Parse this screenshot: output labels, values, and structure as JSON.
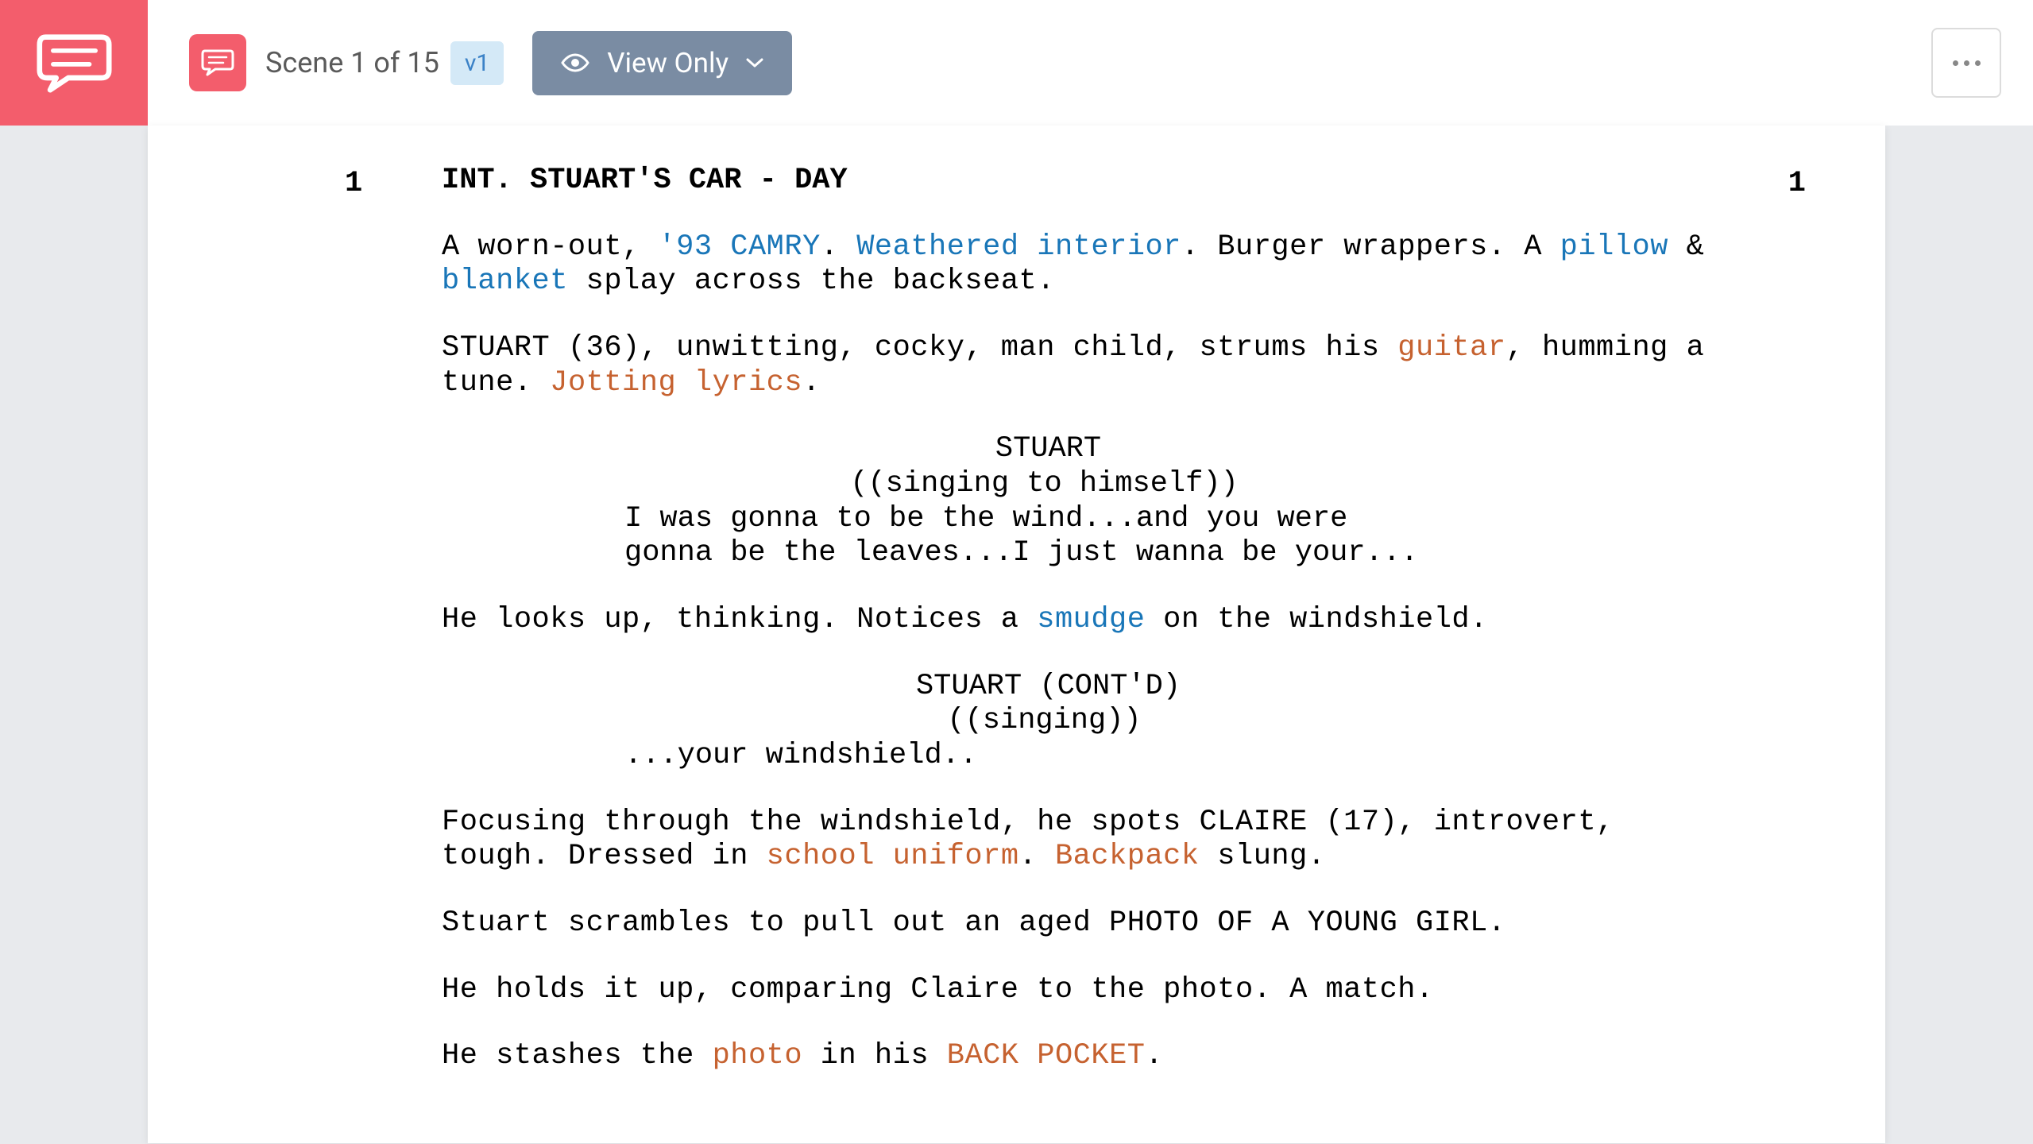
{
  "toolbar": {
    "scene_label": "Scene 1 of 15",
    "version_label": "v1",
    "view_only_label": "View Only"
  },
  "scene": {
    "number_left": "1",
    "number_right": "1",
    "heading": "INT. STUART'S CAR - DAY"
  },
  "action1": {
    "t1": "A worn-out, ",
    "t2": "'93 CAMRY",
    "t3": ". ",
    "t4": "Weathered interior",
    "t5": ". Burger wrappers. A ",
    "t6": "pillow",
    "t7": " & ",
    "t8": "blanket",
    "t9": " splay across the backseat."
  },
  "action2": {
    "t1": "STUART (36), unwitting, cocky, man child, strums his ",
    "t2": "guitar",
    "t3": ", humming a tune. ",
    "t4": "Jotting lyrics",
    "t5": "."
  },
  "dialogue1": {
    "character": "STUART",
    "parenthetical": "((singing to himself))",
    "text": "I was gonna to be the wind...and you were gonna be the leaves...I just wanna be your..."
  },
  "action3": {
    "t1": "He looks up, thinking. Notices a ",
    "t2": "smudge",
    "t3": " on the windshield."
  },
  "dialogue2": {
    "character": "STUART (CONT'D)",
    "parenthetical": "((singing))",
    "text": "...your windshield.."
  },
  "action4": {
    "t1": "Focusing through the windshield, he spots CLAIRE (17), introvert, tough. Dressed in ",
    "t2": "school uniform",
    "t3": ". ",
    "t4": "Backpack",
    "t5": " slung."
  },
  "action5": "Stuart scrambles to pull out an aged PHOTO OF A YOUNG GIRL.",
  "action6": "He holds it up, comparing Claire to the photo. A match.",
  "action7": {
    "t1": "He stashes the ",
    "t2": "photo",
    "t3": " in his ",
    "t4": "BACK POCKET",
    "t5": "."
  }
}
